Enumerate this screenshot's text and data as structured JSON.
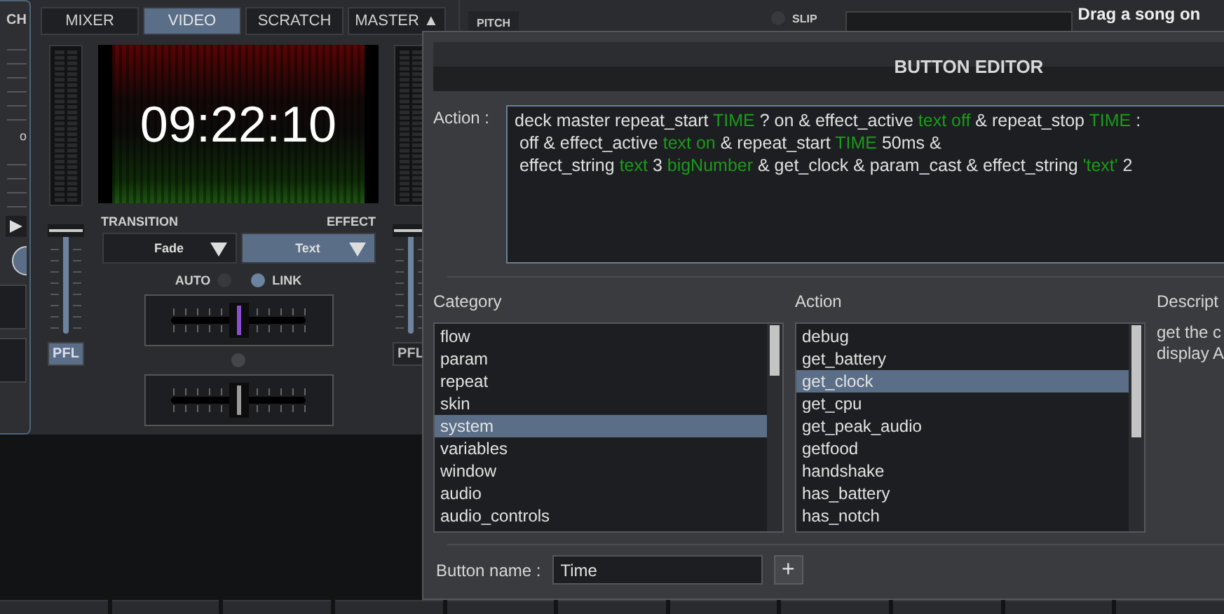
{
  "left_deck": {
    "label": "CH",
    "marker": "o"
  },
  "mixer": {
    "tabs": [
      {
        "label": "MIXER",
        "selected": false
      },
      {
        "label": "VIDEO",
        "selected": true
      },
      {
        "label": "SCRATCH",
        "selected": false
      },
      {
        "label": "MASTER ▲",
        "selected": false
      }
    ],
    "clock": "09:22:10",
    "transition": {
      "label": "TRANSITION",
      "value": "Fade",
      "active": false
    },
    "effect": {
      "label": "EFFECT",
      "value": "Text",
      "active": true
    },
    "pfl": [
      {
        "label": "PFL",
        "on": true
      },
      {
        "label": "PFL",
        "on": false
      }
    ],
    "auto": {
      "label": "AUTO",
      "on": false
    },
    "link": {
      "label": "LINK",
      "on": true
    },
    "crossfaders": [
      {
        "level": 0.5,
        "color": "#8a4fd0"
      },
      {
        "level": 0.5,
        "color": "#9a9a9a"
      }
    ]
  },
  "right_deck": {
    "pitch_label": "PITCH",
    "slip": {
      "label": "SLIP",
      "on": false
    },
    "song_prompt": "Drag a song on"
  },
  "dialog": {
    "title": "BUTTON EDITOR",
    "action_label": "Action :",
    "action_lines": [
      [
        {
          "text": "deck master repeat_start ",
          "highlight": false
        },
        {
          "text": "TIME",
          "highlight": true
        },
        {
          "text": " ? on & effect_active ",
          "highlight": false
        },
        {
          "text": "text off",
          "highlight": true
        },
        {
          "text": " & repeat_stop ",
          "highlight": false
        },
        {
          "text": "TIME",
          "highlight": true
        },
        {
          "text": " :",
          "highlight": false
        }
      ],
      [
        {
          "text": " off & effect_active ",
          "highlight": false
        },
        {
          "text": "text on",
          "highlight": true
        },
        {
          "text": " & repeat_start ",
          "highlight": false
        },
        {
          "text": "TIME",
          "highlight": true
        },
        {
          "text": " 50ms &",
          "highlight": false
        }
      ],
      [
        {
          "text": " effect_string ",
          "highlight": false
        },
        {
          "text": "text",
          "highlight": true
        },
        {
          "text": " 3 ",
          "highlight": false
        },
        {
          "text": "bigNumber",
          "highlight": true
        },
        {
          "text": " & get_clock & param_cast & effect_string ",
          "highlight": false
        },
        {
          "text": "'text'",
          "highlight": true
        },
        {
          "text": " 2",
          "highlight": false
        }
      ]
    ],
    "category": {
      "label": "Category",
      "items": [
        {
          "label": "flow",
          "selected": false
        },
        {
          "label": "param",
          "selected": false
        },
        {
          "label": "repeat",
          "selected": false
        },
        {
          "label": "skin",
          "selected": false
        },
        {
          "label": "system",
          "selected": true
        },
        {
          "label": "variables",
          "selected": false
        },
        {
          "label": "window",
          "selected": false
        },
        {
          "label": "audio",
          "selected": false
        },
        {
          "label": "audio_controls",
          "selected": false
        }
      ]
    },
    "actions": {
      "label": "Action",
      "items": [
        {
          "label": "debug",
          "selected": false
        },
        {
          "label": "get_battery",
          "selected": false
        },
        {
          "label": "get_clock",
          "selected": true
        },
        {
          "label": "get_cpu",
          "selected": false
        },
        {
          "label": "get_peak_audio",
          "selected": false
        },
        {
          "label": "getfood",
          "selected": false
        },
        {
          "label": "handshake",
          "selected": false
        },
        {
          "label": "has_battery",
          "selected": false
        },
        {
          "label": "has_notch",
          "selected": false
        }
      ]
    },
    "description": {
      "label": "Descript",
      "lines": [
        "get the c",
        "display A"
      ]
    },
    "button_name": {
      "label": "Button name :",
      "value": "Time"
    },
    "add_button": "+"
  }
}
